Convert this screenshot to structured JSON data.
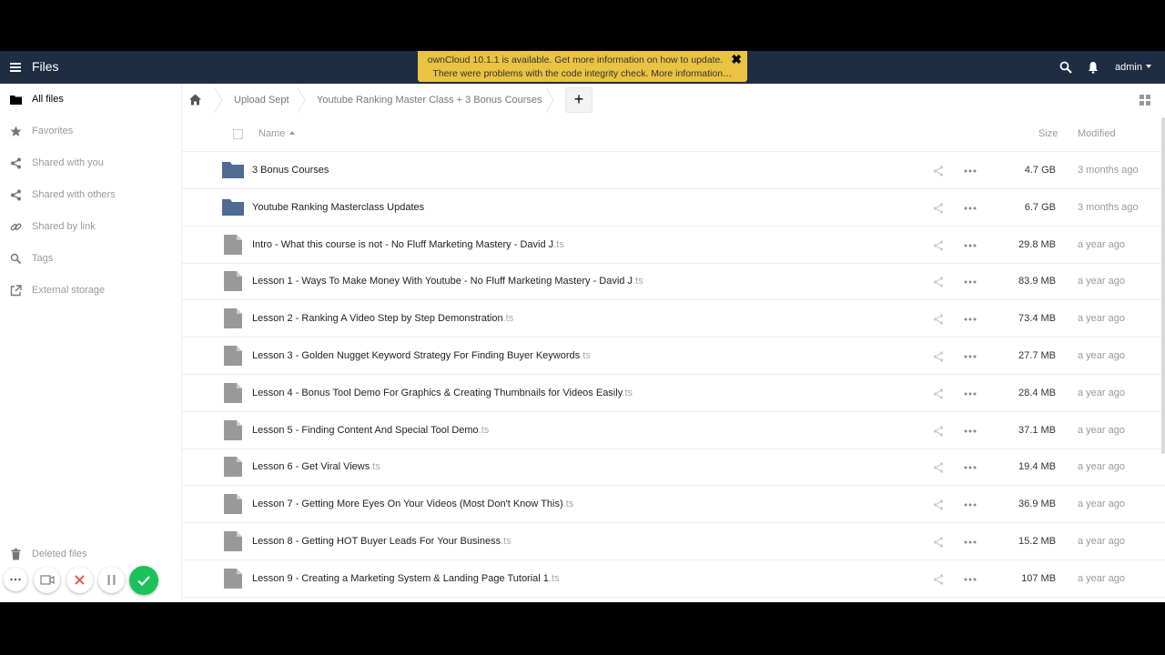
{
  "header": {
    "app_title": "Files",
    "user": "admin",
    "icons": {
      "menu": "hamburger-menu-icon",
      "search": "search-icon",
      "notifications": "bell-icon"
    }
  },
  "notification": {
    "line1": "ownCloud 10.1.1 is available. Get more information on how to update.",
    "line2": "There were problems with the code integrity check. More information…",
    "close": "✖"
  },
  "sidebar": {
    "items": [
      {
        "label": "All files",
        "icon": "folder-icon",
        "active": true
      },
      {
        "label": "Favorites",
        "icon": "star-icon",
        "active": false
      },
      {
        "label": "Shared with you",
        "icon": "share-icon",
        "active": false
      },
      {
        "label": "Shared with others",
        "icon": "share-icon",
        "active": false
      },
      {
        "label": "Shared by link",
        "icon": "link-icon",
        "active": false
      },
      {
        "label": "Tags",
        "icon": "tag-icon",
        "active": false
      },
      {
        "label": "External storage",
        "icon": "external-link-icon",
        "active": false
      }
    ],
    "deleted_files": "Deleted files"
  },
  "breadcrumb": {
    "items": [
      "Upload Sept",
      "Youtube Ranking Master Class + 3 Bonus Courses"
    ],
    "new_button": "+"
  },
  "table": {
    "columns": {
      "name": "Name",
      "size": "Size",
      "modified": "Modified"
    },
    "rows": [
      {
        "type": "folder",
        "name": "3 Bonus Courses",
        "ext": "",
        "size": "4.7 GB",
        "modified": "3 months ago"
      },
      {
        "type": "folder",
        "name": "Youtube Ranking Masterclass Updates",
        "ext": "",
        "size": "6.7 GB",
        "modified": "3 months ago"
      },
      {
        "type": "file",
        "name": "Intro - What this course is not - No Fluff Marketing Mastery - David J",
        "ext": ".ts",
        "size": "29.8 MB",
        "modified": "a year ago"
      },
      {
        "type": "file",
        "name": "Lesson 1 - Ways To Make Money With Youtube - No Fluff Marketing Mastery - David J",
        "ext": ".ts",
        "size": "83.9 MB",
        "modified": "a year ago"
      },
      {
        "type": "file",
        "name": "Lesson 2 - Ranking A Video Step by Step Demonstration",
        "ext": ".ts",
        "size": "73.4 MB",
        "modified": "a year ago"
      },
      {
        "type": "file",
        "name": "Lesson 3 - Golden Nugget Keyword Strategy For Finding Buyer Keywords",
        "ext": ".ts",
        "size": "27.7 MB",
        "modified": "a year ago"
      },
      {
        "type": "file",
        "name": "Lesson 4 - Bonus Tool Demo For Graphics & Creating Thumbnails for Videos Easily",
        "ext": ".ts",
        "size": "28.4 MB",
        "modified": "a year ago"
      },
      {
        "type": "file",
        "name": "Lesson 5 - Finding Content And Special Tool Demo",
        "ext": ".ts",
        "size": "37.1 MB",
        "modified": "a year ago"
      },
      {
        "type": "file",
        "name": "Lesson 6 - Get Viral Views",
        "ext": ".ts",
        "size": "19.4 MB",
        "modified": "a year ago"
      },
      {
        "type": "file",
        "name": "Lesson 7 - Getting More Eyes On Your Videos (Most Don't Know This)",
        "ext": ".ts",
        "size": "36.9 MB",
        "modified": "a year ago"
      },
      {
        "type": "file",
        "name": "Lesson 8 - Getting HOT Buyer Leads For Your Business",
        "ext": ".ts",
        "size": "15.2 MB",
        "modified": "a year ago"
      },
      {
        "type": "file",
        "name": "Lesson 9 - Creating a Marketing System & Landing Page Tutorial 1",
        "ext": ".ts",
        "size": "107 MB",
        "modified": "a year ago"
      }
    ]
  },
  "colors": {
    "header_bg": "#1d2d44",
    "folder": "#4f6b93",
    "notice_bg": "#e9c341",
    "confirm_green": "#1bc25a",
    "cancel_red": "#e05a5a"
  }
}
